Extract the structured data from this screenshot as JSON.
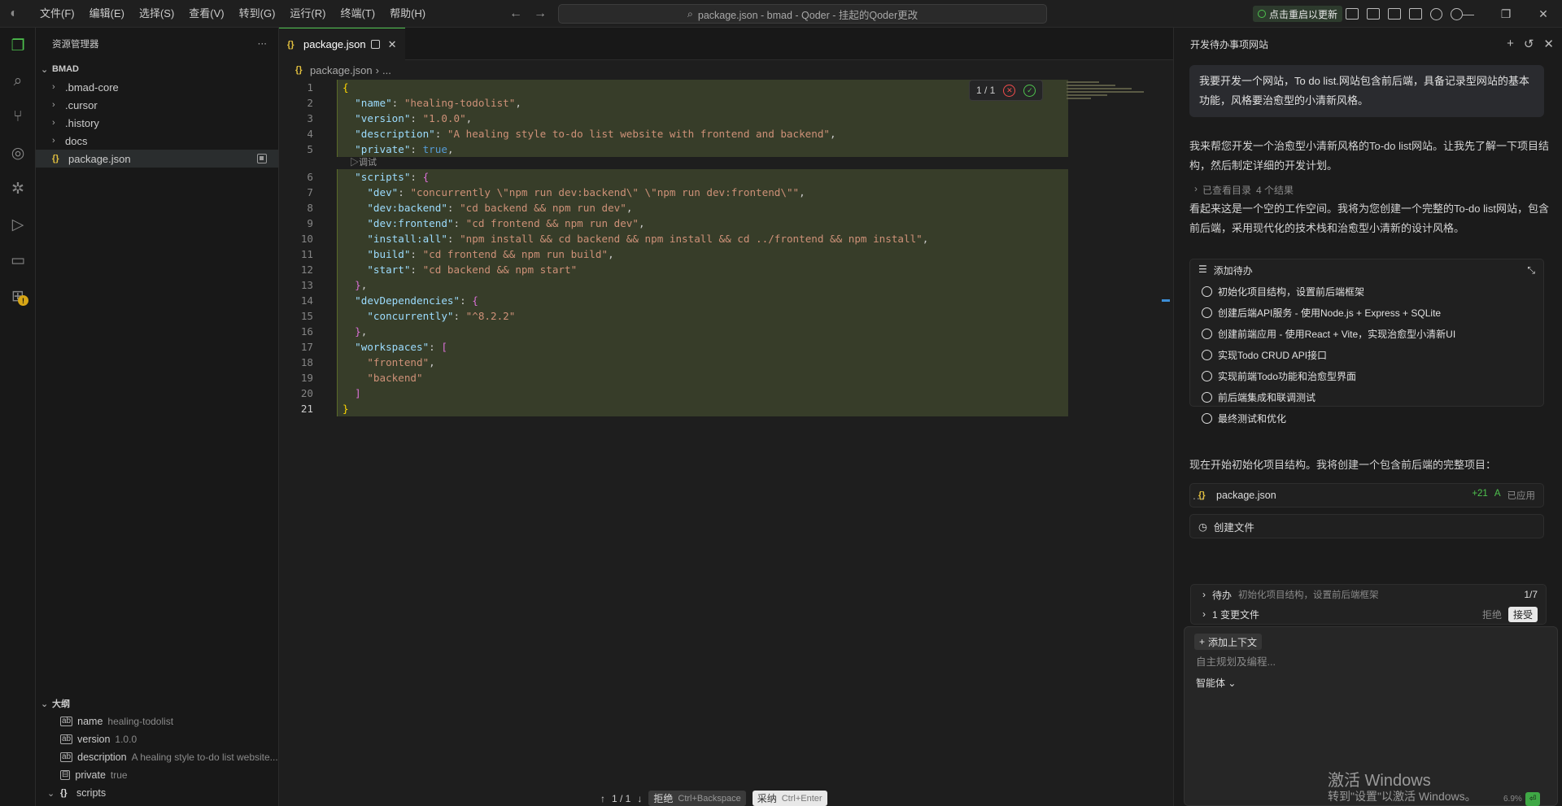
{
  "menu": [
    "文件(F)",
    "编辑(E)",
    "选择(S)",
    "查看(V)",
    "转到(G)",
    "运行(R)",
    "终端(T)",
    "帮助(H)"
  ],
  "command_center": "package.json - bmad - Qoder - 挂起的Qoder更改",
  "restart_label": "点击重启以更新",
  "sidebar": {
    "title": "资源管理器",
    "root": "BMAD",
    "items": [
      ".bmad-core",
      ".cursor",
      ".history",
      "docs",
      "package.json"
    ],
    "outline_title": "大纲",
    "outline": [
      {
        "name": "name",
        "detail": "healing-todolist"
      },
      {
        "name": "version",
        "detail": "1.0.0"
      },
      {
        "name": "description",
        "detail": "A healing style to-do list website..."
      },
      {
        "name": "private",
        "detail": "true"
      },
      {
        "name": "scripts",
        "detail": ""
      }
    ]
  },
  "editor": {
    "tab": "package.json",
    "crumb_file": "package.json",
    "crumb_more": "...",
    "diff_counter": "1 / 1",
    "codelens": "调试",
    "nav_counter": "1 / 1",
    "reject_label": "拒绝",
    "reject_shortcut": "Ctrl+Backspace",
    "accept_label": "采纳",
    "accept_shortcut": "Ctrl+Enter",
    "lines": [
      "1",
      "2",
      "3",
      "4",
      "5",
      "6",
      "7",
      "8",
      "9",
      "10",
      "11",
      "12",
      "13",
      "14",
      "15",
      "16",
      "17",
      "18",
      "19",
      "20",
      "21"
    ]
  },
  "chat": {
    "title": "开发待办事项网站",
    "user_message": "我要开发一个网站，To do list.网站包含前后端，具备记录型网站的基本功能，风格要治愈型的小清新风格。",
    "ai_1": "我来帮您开发一个治愈型小清新风格的To-do list网站。让我先了解一下项目结构，然后制定详细的开发计划。",
    "viewed_dir": "已查看目录",
    "viewed_results": "4 个结果",
    "ai_2": "看起来这是一个空的工作空间。我将为您创建一个完整的To-do list网站，包含前后端，采用现代化的技术栈和治愈型小清新的设计风格。",
    "todo_title": "添加待办",
    "todos": [
      "初始化项目结构，设置前后端框架",
      "创建后端API服务 - 使用Node.js + Express + SQLite",
      "创建前端应用 - 使用React + Vite，实现治愈型小清新UI",
      "实现Todo CRUD API接口",
      "实现前端Todo功能和治愈型界面",
      "前后端集成和联调测试",
      "最终测试和优化"
    ],
    "ai_3": "现在开始初始化项目结构。我将创建一个包含前后端的完整项目：",
    "file_name": "package.json",
    "file_added": "+21",
    "file_status_letter": "A",
    "file_status": "已应用",
    "create_file": "创建文件",
    "loading": "...",
    "pending_label": "待办",
    "pending_item": "初始化项目结构，设置前后端框架",
    "pending_count": "1/7",
    "changes_label": "1 变更文件",
    "changes_reject": "拒绝",
    "changes_accept": "接受",
    "add_context": "添加上下文",
    "placeholder": "自主规划及编程...",
    "agent": "智能体",
    "usage": "6.9%"
  },
  "watermark": {
    "line1": "激活 Windows",
    "line2": "转到\"设置\"以激活 Windows。"
  }
}
